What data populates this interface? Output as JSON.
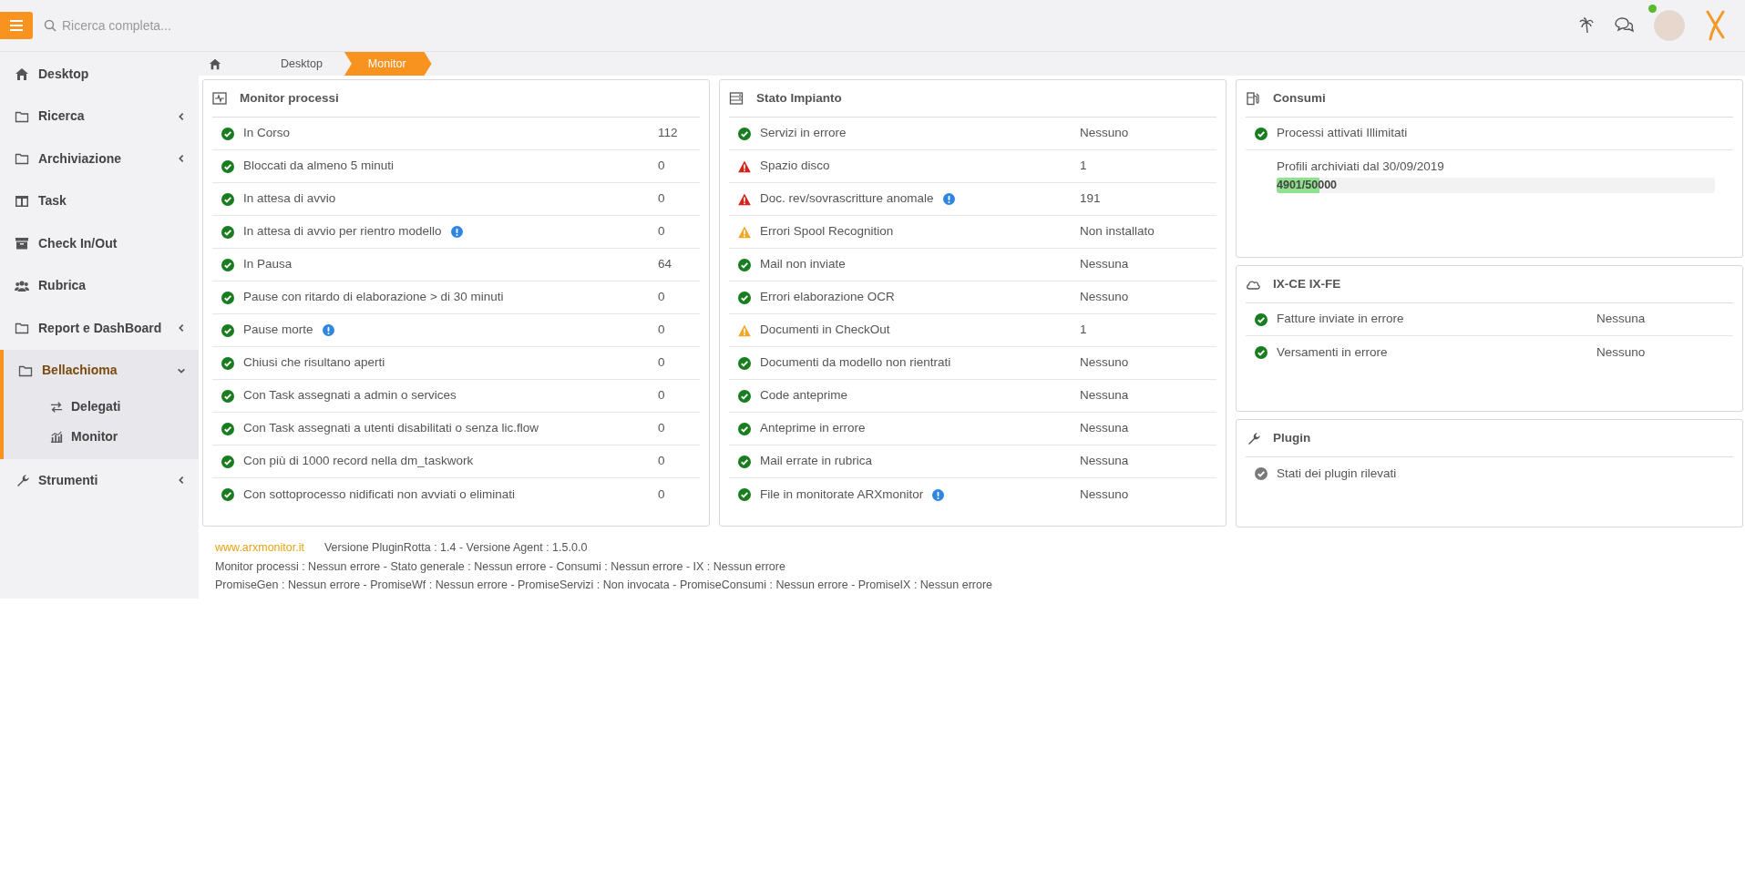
{
  "topbar": {
    "search": {
      "placeholder": "Ricerca completa..."
    }
  },
  "sidebar": {
    "items": [
      {
        "kind": "link",
        "label": "Desktop"
      },
      {
        "kind": "group",
        "label": "Ricerca",
        "expanded": false
      },
      {
        "kind": "group",
        "label": "Archiviazione",
        "expanded": false
      },
      {
        "kind": "link",
        "label": "Task"
      },
      {
        "kind": "link",
        "label": "Check In/Out"
      },
      {
        "kind": "link",
        "label": "Rubrica"
      },
      {
        "kind": "group",
        "label": "Report e DashBoard",
        "expanded": false
      },
      {
        "kind": "group",
        "label": "Bellachioma",
        "expanded": true,
        "children": [
          {
            "label": "Delegati"
          },
          {
            "label": "Monitor"
          }
        ]
      },
      {
        "kind": "group",
        "label": "Strumenti",
        "expanded": false
      }
    ]
  },
  "breadcrumb": [
    {
      "kind": "home"
    },
    {
      "kind": "page",
      "label": "Desktop",
      "selected": false
    },
    {
      "kind": "page",
      "label": "Monitor",
      "selected": true
    }
  ],
  "panels": [
    {
      "title": "Monitor processi",
      "rows": [
        {
          "kind": "ok",
          "label": "In Corso",
          "info": false,
          "value": "112"
        },
        {
          "kind": "ok",
          "label": "Bloccati da almeno 5 minuti",
          "info": false,
          "value": "0"
        },
        {
          "kind": "ok",
          "label": "In attesa di avvio",
          "info": false,
          "value": "0"
        },
        {
          "kind": "ok",
          "label": "In attesa di avvio per rientro modello",
          "info": true,
          "value": "0"
        },
        {
          "kind": "ok",
          "label": "In Pausa",
          "info": false,
          "value": "64"
        },
        {
          "kind": "ok",
          "label": "Pause con ritardo di elaborazione > di 30 minuti",
          "info": false,
          "value": "0"
        },
        {
          "kind": "ok",
          "label": "Pause morte",
          "info": true,
          "value": "0"
        },
        {
          "kind": "ok",
          "label": "Chiusi che risultano aperti",
          "info": false,
          "value": "0"
        },
        {
          "kind": "ok",
          "label": "Con Task assegnati a admin o services",
          "info": false,
          "value": "0"
        },
        {
          "kind": "ok",
          "label": "Con Task assegnati a utenti disabilitati o senza lic.flow",
          "info": false,
          "value": "0"
        },
        {
          "kind": "ok",
          "label": "Con più di 1000 record nella dm_taskwork",
          "info": false,
          "value": "0"
        },
        {
          "kind": "ok",
          "label": "Con sottoprocesso nidificati non avviati o eliminati",
          "info": false,
          "value": "0"
        }
      ]
    },
    {
      "title": "Stato Impianto",
      "rows": [
        {
          "kind": "ok",
          "label": "Servizi in errore",
          "info": false,
          "value": "Nessuno"
        },
        {
          "kind": "error",
          "label": "Spazio disco",
          "info": false,
          "value": "1"
        },
        {
          "kind": "error",
          "label": "Doc. rev/sovrascritture anomale",
          "info": true,
          "value": "191"
        },
        {
          "kind": "warning",
          "label": "Errori Spool Recognition",
          "info": false,
          "value": "Non installato"
        },
        {
          "kind": "ok",
          "label": "Mail non inviate",
          "info": false,
          "value": "Nessuna"
        },
        {
          "kind": "ok",
          "label": "Errori elaborazione OCR",
          "info": false,
          "value": "Nessuno"
        },
        {
          "kind": "warning",
          "label": "Documenti in CheckOut",
          "info": false,
          "value": "1"
        },
        {
          "kind": "ok",
          "label": "Documenti da modello non rientrati",
          "info": false,
          "value": "Nessuno"
        },
        {
          "kind": "ok",
          "label": "Code anteprime",
          "info": false,
          "value": "Nessuna"
        },
        {
          "kind": "ok",
          "label": "Anteprime in errore",
          "info": false,
          "value": "Nessuna"
        },
        {
          "kind": "ok",
          "label": "Mail errate in rubrica",
          "info": false,
          "value": "Nessuna"
        },
        {
          "kind": "ok",
          "label": "File in monitorate ARXmonitor",
          "info": true,
          "value": "Nessuno"
        }
      ]
    },
    {
      "title": "Consumi",
      "rows": [
        {
          "kind": "ok",
          "label": "Processi attivati Illimitati",
          "info": false
        },
        {
          "kind": "progress",
          "label": "Profili archiviati dal 30/09/2019",
          "reading": "4901/50000",
          "level": 0.098
        }
      ]
    },
    {
      "title": "IX-CE IX-FE",
      "rows": [
        {
          "kind": "ok",
          "label": "Fatture inviate in errore",
          "info": false,
          "value": "Nessuna"
        },
        {
          "kind": "ok",
          "label": "Versamenti in errore",
          "info": false,
          "value": "Nessuno"
        }
      ]
    },
    {
      "title": "Plugin",
      "rows": [
        {
          "kind": "neutral",
          "label": "Stati dei plugin rilevati",
          "info": false
        }
      ]
    }
  ],
  "footer": {
    "link": "www.arxmonitor.it",
    "version": "Versione PluginRotta : 1.4 - Versione Agent : 1.5.0.0",
    "lines": [
      "Monitor processi : Nessun errore - Stato generale : Nessun errore - Consumi : Nessun errore - IX : Nessun errore",
      "PromiseGen : Nessun errore - PromiseWf : Nessun errore - PromiseServizi : Non invocata - PromiseConsumi : Nessun errore - PromiseIX : Nessun errore"
    ]
  }
}
